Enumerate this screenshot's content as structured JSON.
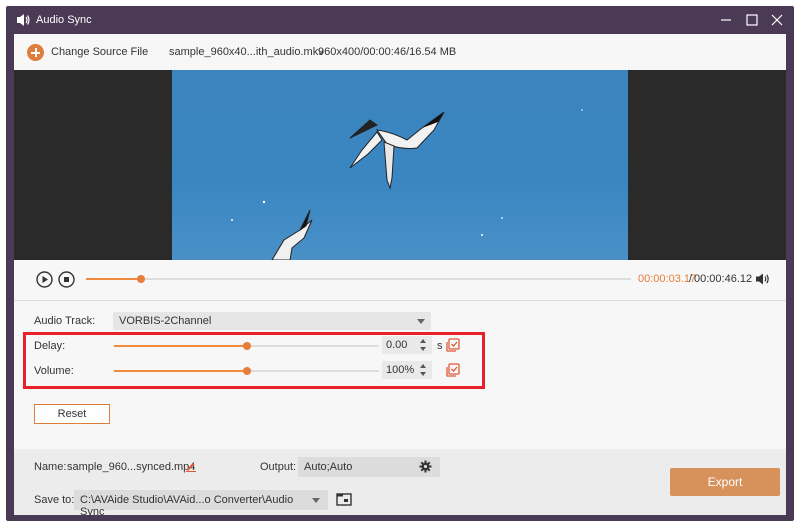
{
  "window": {
    "title": "Audio Sync",
    "controls": [
      "minimize-icon",
      "maximize-icon",
      "close-icon"
    ]
  },
  "source": {
    "change_label": "Change Source File",
    "file_name": "sample_960x40...ith_audio.mkv",
    "file_info": "960x400/00:00:46/16.54 MB"
  },
  "player": {
    "time_current": "00:00:03.17",
    "time_separator": "/",
    "time_total": "00:00:46.12",
    "progress_fraction": 0.1,
    "accent_color": "#e67e3a"
  },
  "audio": {
    "track_label": "Audio Track:",
    "track_value": "VORBIS-2Channel",
    "delay_label": "Delay:",
    "delay_value": "0.00",
    "delay_unit": "s",
    "delay_slider_fraction": 0.5,
    "volume_label": "Volume:",
    "volume_value": "100%",
    "volume_slider_fraction": 0.5,
    "reset_label": "Reset",
    "highlight_color": "#e8202a"
  },
  "output": {
    "name_label": "Name:",
    "name_value": "sample_960...synced.mp4",
    "output_label": "Output:",
    "output_value": "Auto;Auto",
    "save_label": "Save to:",
    "save_path": "C:\\AVAide Studio\\AVAid...o Converter\\Audio Sync",
    "export_label": "Export"
  }
}
